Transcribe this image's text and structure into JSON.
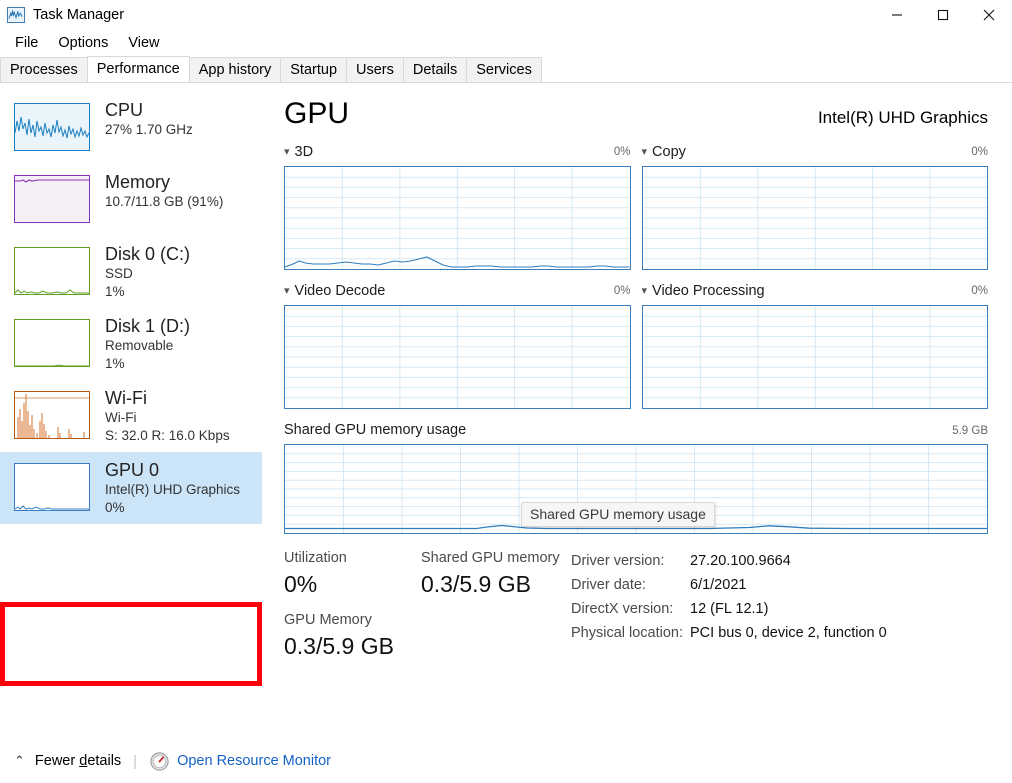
{
  "window": {
    "title": "Task Manager",
    "icon": "task-manager-icon",
    "minimize": "–",
    "maximize": "□",
    "close": "✕"
  },
  "menu": {
    "items": [
      "File",
      "Options",
      "View"
    ]
  },
  "tabs": {
    "items": [
      "Processes",
      "Performance",
      "App history",
      "Startup",
      "Users",
      "Details",
      "Services"
    ],
    "active": "Performance"
  },
  "sidebar": {
    "items": [
      {
        "title": "CPU",
        "sub1": "27% 1.70 GHz",
        "sub2": "",
        "color": "#1a7fc1",
        "fill": "#eaf4fb",
        "selected": false
      },
      {
        "title": "Memory",
        "sub1": "10.7/11.8 GB (91%)",
        "sub2": "",
        "color": "#8a2fb4",
        "fill": "#f5f0f7",
        "selected": false
      },
      {
        "title": "Disk 0 (C:)",
        "sub1": "SSD",
        "sub2": "1%",
        "color": "#5f9e20",
        "fill": "#ffffff",
        "selected": false
      },
      {
        "title": "Disk 1 (D:)",
        "sub1": "Removable",
        "sub2": "1%",
        "color": "#5f9e20",
        "fill": "#ffffff",
        "selected": false
      },
      {
        "title": "Wi-Fi",
        "sub1": "Wi-Fi",
        "sub2": "S: 32.0 R: 16.0 Kbps",
        "color": "#b05a16",
        "fill": "#ffffff",
        "selected": false
      },
      {
        "title": "GPU 0",
        "sub1": "Intel(R) UHD Graphics",
        "sub2": "0%",
        "color": "#3a7ebf",
        "fill": "#ffffff",
        "selected": true
      }
    ]
  },
  "main": {
    "title": "GPU",
    "device": "Intel(R) UHD Graphics",
    "charts": [
      {
        "label": "3D",
        "value": "0%"
      },
      {
        "label": "Copy",
        "value": "0%"
      },
      {
        "label": "Video Decode",
        "value": "0%"
      },
      {
        "label": "Video Processing",
        "value": "0%"
      }
    ],
    "memory_chart": {
      "label": "Shared GPU memory usage",
      "value": "5.9 GB"
    },
    "tooltip": "Shared GPU memory usage",
    "stats": {
      "utilization_label": "Utilization",
      "utilization_value": "0%",
      "gpu_memory_label": "GPU Memory",
      "gpu_memory_value": "0.3/5.9 GB",
      "shared_label": "Shared GPU memory",
      "shared_value": "0.3/5.9 GB",
      "details": [
        {
          "key": "Driver version:",
          "value": "27.20.100.9664"
        },
        {
          "key": "Driver date:",
          "value": "6/1/2021"
        },
        {
          "key": "DirectX version:",
          "value": "12 (FL 12.1)"
        },
        {
          "key": "Physical location:",
          "value": "PCI bus 0, device 2, function 0"
        }
      ]
    }
  },
  "footer": {
    "caret": "⌃",
    "fewer_details_pre": "Fewer ",
    "fewer_details_key": "d",
    "fewer_details_post": "etails",
    "separator": "|",
    "resource_monitor": "Open Resource Monitor"
  },
  "annotation": {
    "color": "#fb0007"
  },
  "chart_data": {
    "type": "line",
    "title": "GPU engine utilization over 60 seconds",
    "ylim": [
      0,
      100
    ],
    "ylabel": "%",
    "grid": true,
    "series": [
      {
        "name": "3D",
        "values": [
          1,
          2,
          3,
          2,
          2,
          2,
          2,
          2,
          3,
          3,
          2,
          2,
          2,
          1,
          2,
          3,
          3,
          2,
          3,
          4,
          5,
          3,
          1,
          0,
          0,
          0,
          0,
          0,
          1,
          1,
          1,
          0,
          0,
          0,
          0,
          0,
          0,
          0,
          0,
          0,
          0,
          0,
          0,
          0,
          0,
          1,
          1,
          0,
          0,
          0,
          0,
          0,
          0,
          0,
          0,
          0,
          0,
          0,
          0,
          0
        ]
      },
      {
        "name": "Copy",
        "values": [
          0,
          0,
          0,
          0,
          0,
          0,
          0,
          0,
          0,
          0,
          0,
          0,
          0,
          0,
          0,
          0,
          0,
          0,
          0,
          0,
          0,
          0,
          0,
          0,
          0,
          0,
          0,
          0,
          0,
          0,
          0,
          0,
          0,
          0,
          0,
          0,
          0,
          0,
          0,
          0,
          0,
          0,
          0,
          0,
          0,
          0,
          0,
          0,
          0,
          0,
          0,
          0,
          0,
          0,
          0,
          0,
          0,
          0,
          0,
          0
        ]
      },
      {
        "name": "Video Decode",
        "values": [
          0,
          0,
          0,
          0,
          0,
          0,
          0,
          0,
          0,
          0,
          0,
          0,
          0,
          0,
          0,
          0,
          0,
          0,
          0,
          0,
          0,
          0,
          0,
          0,
          0,
          0,
          0,
          0,
          0,
          0,
          0,
          0,
          0,
          0,
          0,
          0,
          0,
          0,
          0,
          0,
          0,
          0,
          0,
          0,
          0,
          0,
          0,
          0,
          0,
          0,
          0,
          0,
          0,
          0,
          0,
          0,
          0,
          0,
          0,
          0
        ]
      },
      {
        "name": "Video Processing",
        "values": [
          0,
          0,
          0,
          0,
          0,
          0,
          0,
          0,
          0,
          0,
          0,
          0,
          0,
          0,
          0,
          0,
          0,
          0,
          0,
          0,
          0,
          0,
          0,
          0,
          0,
          0,
          0,
          0,
          0,
          0,
          0,
          0,
          0,
          0,
          0,
          0,
          0,
          0,
          0,
          0,
          0,
          0,
          0,
          0,
          0,
          0,
          0,
          0,
          0,
          0,
          0,
          0,
          0,
          0,
          0,
          0,
          0,
          0,
          0,
          0
        ]
      },
      {
        "name": "Shared GPU memory usage",
        "ylim": [
          0,
          5.9
        ],
        "ylabel": "GB",
        "values": [
          0.3,
          0.3,
          0.3,
          0.3,
          0.3,
          0.3,
          0.3,
          0.3,
          0.3,
          0.3,
          0.3,
          0.3,
          0.3,
          0.3,
          0.3,
          0.3,
          0.3,
          0.32,
          0.34,
          0.33,
          0.31,
          0.3,
          0.3,
          0.3,
          0.3,
          0.3,
          0.3,
          0.3,
          0.3,
          0.3,
          0.3,
          0.3,
          0.3,
          0.3,
          0.3,
          0.3,
          0.3,
          0.3,
          0.3,
          0.3,
          0.3,
          0.3,
          0.32,
          0.34,
          0.33,
          0.31,
          0.3,
          0.3,
          0.3,
          0.3,
          0.3,
          0.3,
          0.3,
          0.3,
          0.3,
          0.3,
          0.3,
          0.3,
          0.3,
          0.3
        ]
      }
    ]
  }
}
